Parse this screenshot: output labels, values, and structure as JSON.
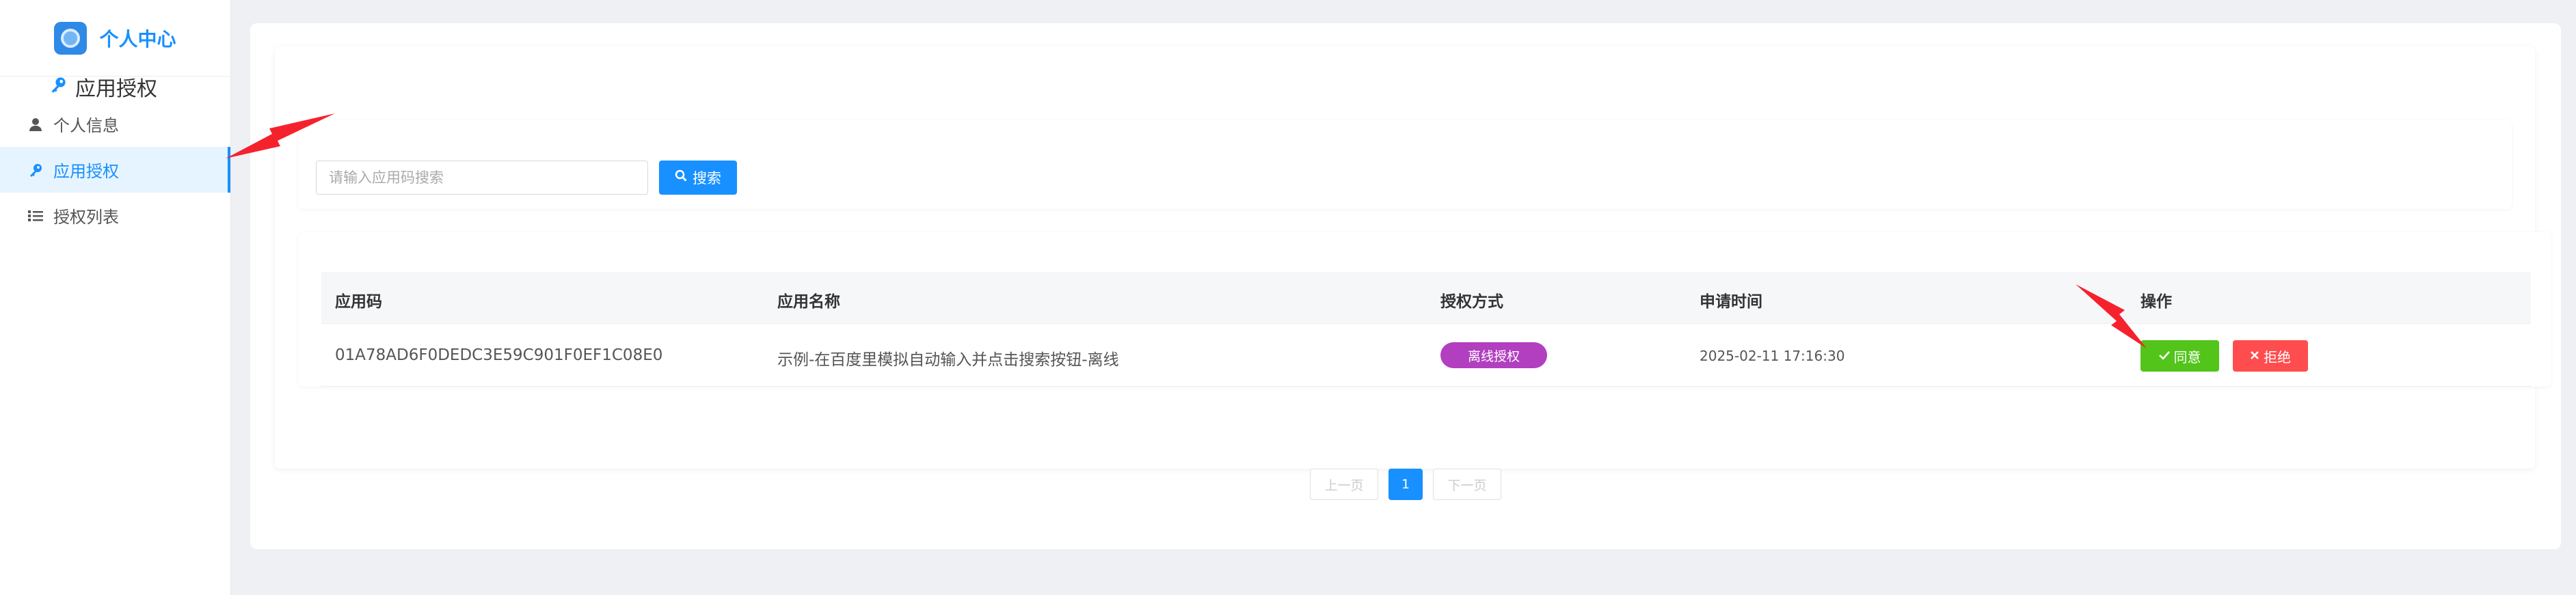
{
  "brand": {
    "title": "个人中心"
  },
  "sidebar": {
    "items": [
      {
        "label": "个人信息",
        "icon": "user-icon",
        "active": false
      },
      {
        "label": "应用授权",
        "icon": "key-icon",
        "active": true
      },
      {
        "label": "授权列表",
        "icon": "list-icon",
        "active": false
      }
    ]
  },
  "page": {
    "title": "应用授权",
    "title_icon": "key-icon"
  },
  "search": {
    "placeholder": "请输入应用码搜索",
    "button_label": "搜索",
    "button_icon": "search-icon"
  },
  "table": {
    "headers": [
      "应用码",
      "应用名称",
      "授权方式",
      "申请时间",
      "操作"
    ],
    "rows": [
      {
        "app_code": "01A78AD6F0DEDC3E59C901F0EF1C08E0",
        "app_name": "示例-在百度里模拟自动输入并点击搜索按钮-离线",
        "auth_type": "离线授权",
        "apply_time": "2025-02-11 17:16:30",
        "agree_label": "同意",
        "reject_label": "拒绝"
      }
    ]
  },
  "pagination": {
    "prev_label": "上一页",
    "current_page": "1",
    "next_label": "下一页"
  },
  "colors": {
    "primary": "#1890ff",
    "agree": "#52c41a",
    "reject": "#ff4d4f",
    "badge": "#b13fbf",
    "annotation_arrow": "#f5222d"
  }
}
